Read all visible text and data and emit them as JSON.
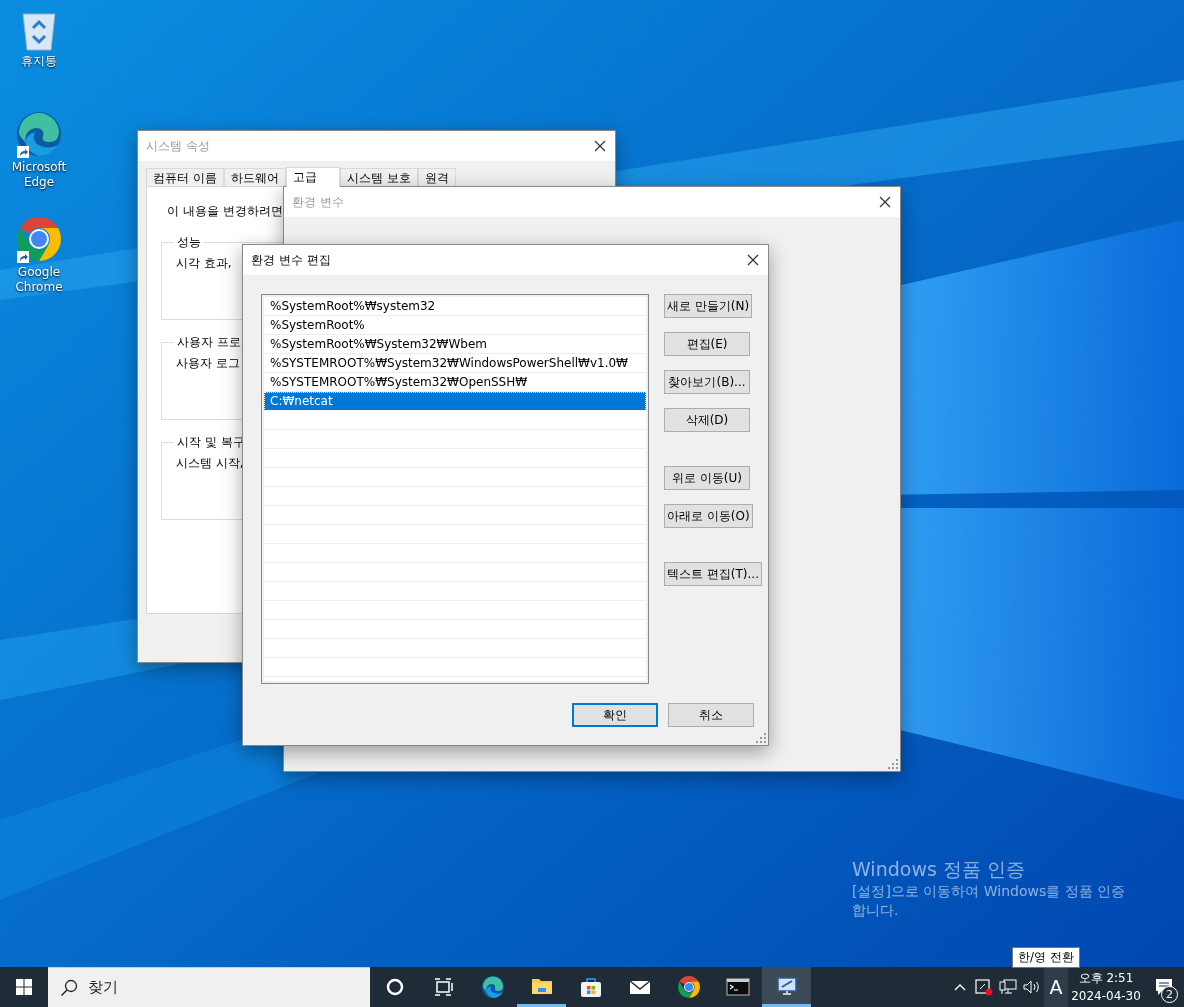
{
  "desktop_icons": [
    {
      "kind": "recycle",
      "label": "휴지통"
    },
    {
      "kind": "edge",
      "label": "Microsoft Edge"
    },
    {
      "kind": "chrome",
      "label": "Google Chrome"
    }
  ],
  "system_properties": {
    "title": "시스템 속성",
    "tabs": [
      {
        "label": "컴퓨터 이름",
        "selected": false
      },
      {
        "label": "하드웨어",
        "selected": false
      },
      {
        "label": "고급",
        "selected": true
      },
      {
        "label": "시스템 보호",
        "selected": false
      },
      {
        "label": "원격",
        "selected": false
      }
    ],
    "intro": "이 내용을 변경하려면",
    "groups": [
      {
        "title": "성능",
        "text": "시각 효과,"
      },
      {
        "title": "사용자 프로",
        "text": "사용자 로그"
      },
      {
        "title": "시작 및 복구",
        "text": "시스템 시작,"
      }
    ]
  },
  "environment_variables": {
    "title": "환경 변수"
  },
  "edit_dialog": {
    "title": "환경 변수 편집",
    "entries": [
      {
        "text": "%SystemRoot%₩system32",
        "selected": false
      },
      {
        "text": "%SystemRoot%",
        "selected": false
      },
      {
        "text": "%SystemRoot%₩System32₩Wbem",
        "selected": false
      },
      {
        "text": "%SYSTEMROOT%₩System32₩WindowsPowerShell₩v1.0₩",
        "selected": false
      },
      {
        "text": "%SYSTEMROOT%₩System32₩OpenSSH₩",
        "selected": false
      },
      {
        "text": "C:₩netcat",
        "selected": true
      }
    ],
    "side_buttons": [
      {
        "label": "새로 만들기(N)"
      },
      {
        "label": "편집(E)"
      },
      {
        "label": "찾아보기(B)..."
      },
      {
        "label": "삭제(D)"
      },
      {
        "label": "위로 이동(U)"
      },
      {
        "label": "아래로 이동(O)"
      },
      {
        "label": "텍스트 편집(T)..."
      }
    ],
    "ok": "확인",
    "cancel": "취소"
  },
  "activation": {
    "title": "Windows 정품 인증",
    "message": "[설정]으로 이동하여 Windows를 정품 인증 합니다."
  },
  "taskbar": {
    "search_placeholder": "찾기",
    "apps": [
      {
        "kind": "cortana",
        "running": false,
        "selected": false
      },
      {
        "kind": "taskview",
        "running": false,
        "selected": false
      },
      {
        "kind": "edge",
        "running": false,
        "selected": false
      },
      {
        "kind": "folder",
        "running": true,
        "selected": false
      },
      {
        "kind": "store",
        "running": false,
        "selected": false
      },
      {
        "kind": "mail",
        "running": false,
        "selected": false
      },
      {
        "kind": "chrome",
        "running": false,
        "selected": false
      },
      {
        "kind": "terminal",
        "running": false,
        "selected": false
      },
      {
        "kind": "remote",
        "running": true,
        "selected": true
      }
    ],
    "ime": "A",
    "time": "오후 2:51",
    "date": "2024-04-30",
    "notifications": "2",
    "tooltip": "한/영 전환"
  }
}
